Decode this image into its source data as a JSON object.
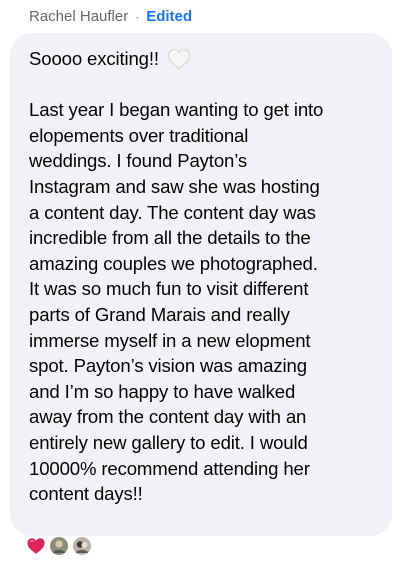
{
  "comment": {
    "author": "Rachel Haufler",
    "separator": "·",
    "edited_label": "Edited",
    "opening_line": "Soooo exciting!!",
    "heart_emoji": "white-heart-icon",
    "body_lines": [
      "Last year I began wanting to get into",
      "elopements over traditional",
      "weddings. I found Payton’s",
      "Instagram and saw she was hosting",
      "a content day. The content day was",
      "incredible from all the details to the",
      "amazing couples we photographed.",
      "It was so much fun to visit different",
      "parts of Grand Marais and really",
      "immerse myself in a new elopment",
      "spot. Payton’s vision was amazing",
      "and I’m so happy to have walked",
      "away from the content day with an",
      "entirely new gallery to edit. I would",
      "10000% recommend attending her",
      "content days!!"
    ]
  },
  "reactions": [
    {
      "icon": "red-heart-icon",
      "color": "#e0245e"
    },
    {
      "icon": "avatar-reaction-1-icon"
    },
    {
      "icon": "avatar-reaction-2-icon"
    }
  ],
  "colors": {
    "bubble_bg": "#f0f2f5",
    "text": "#050505",
    "meta": "#65676b",
    "edited": "#1877f2"
  }
}
